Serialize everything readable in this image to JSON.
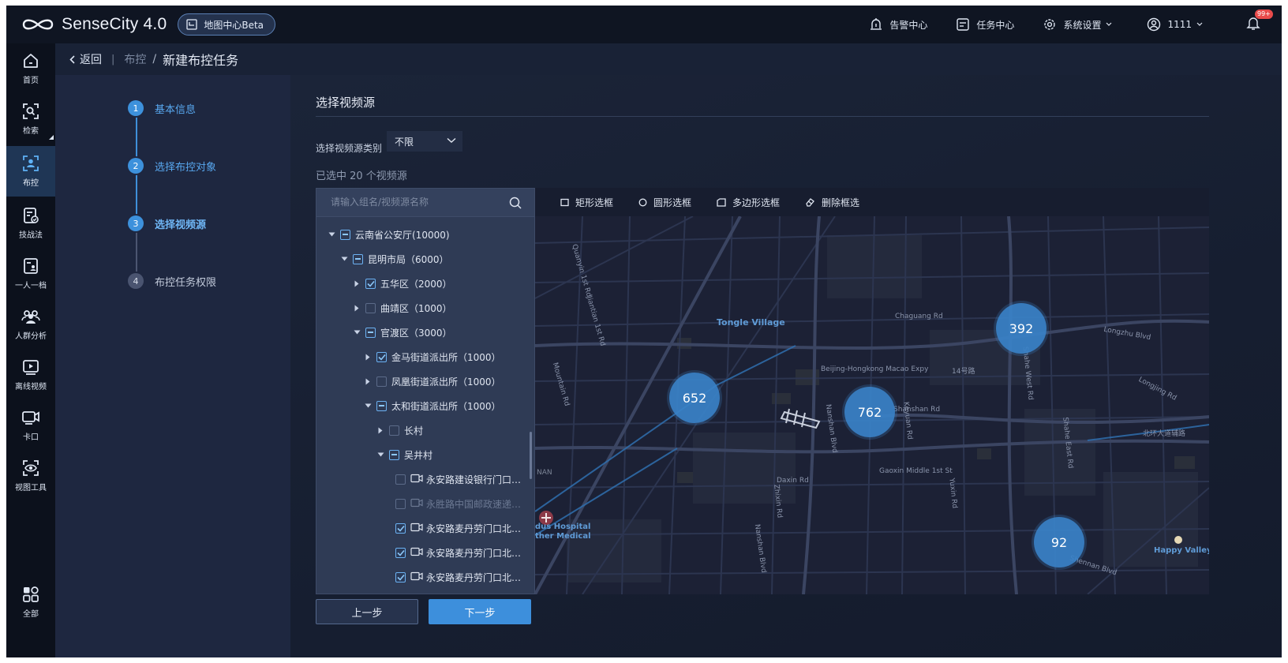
{
  "header": {
    "app_name": "SenseCity 4.0",
    "badge_label": "地图中心Beta",
    "alarm_center": "告警中心",
    "task_center": "任务中心",
    "system_settings": "系统设置",
    "user_name": "1111",
    "notification_count": "99+"
  },
  "nav": {
    "items": [
      {
        "label": "首页",
        "icon": "home-icon"
      },
      {
        "label": "检索",
        "icon": "search-face-icon"
      },
      {
        "label": "布控",
        "icon": "monitor-person-icon",
        "active": true
      },
      {
        "label": "技战法",
        "icon": "tactics-icon"
      },
      {
        "label": "一人一档",
        "icon": "profile-icon"
      },
      {
        "label": "人群分析",
        "icon": "crowd-icon"
      },
      {
        "label": "离线视频",
        "icon": "offline-video-icon"
      },
      {
        "label": "卡口",
        "icon": "checkpoint-camera-icon"
      },
      {
        "label": "视图工具",
        "icon": "view-tool-icon"
      },
      {
        "label": "全部",
        "icon": "all-apps-icon"
      }
    ]
  },
  "breadcrumb": {
    "back": "返回",
    "parent": "布控",
    "separator": "/",
    "current": "新建布控任务"
  },
  "steps": [
    {
      "num": "1",
      "label": "基本信息",
      "state": "done"
    },
    {
      "num": "2",
      "label": "选择布控对象",
      "state": "done"
    },
    {
      "num": "3",
      "label": "选择视频源",
      "state": "current"
    },
    {
      "num": "4",
      "label": "布控任务权限",
      "state": "todo"
    }
  ],
  "main": {
    "section_title": "选择视频源",
    "filter_label": "选择视频源类别",
    "filter_value": "不限",
    "selected_count_text": "已选中 20 个视频源",
    "search_placeholder": "请输入组名/视频源名称"
  },
  "tree": [
    {
      "label": "云南省公安厅(10000)",
      "level": 0,
      "arrow": "down",
      "check": "half"
    },
    {
      "label": "昆明市局（6000）",
      "level": 1,
      "arrow": "down",
      "check": "half"
    },
    {
      "label": "五华区（2000）",
      "level": 2,
      "arrow": "right",
      "check": "on"
    },
    {
      "label": "曲靖区（1000）",
      "level": 2,
      "arrow": "right",
      "check": "off"
    },
    {
      "label": "官渡区（3000）",
      "level": 2,
      "arrow": "down",
      "check": "half"
    },
    {
      "label": "金马街道派出所（1000）",
      "level": 3,
      "arrow": "right",
      "check": "on"
    },
    {
      "label": "凤凰街道派出所（1000）",
      "level": 3,
      "arrow": "right",
      "check": "off"
    },
    {
      "label": "太和街道派出所（1000）",
      "level": 3,
      "arrow": "down",
      "check": "half"
    },
    {
      "label": "长村",
      "level": 4,
      "arrow": "right",
      "check": "off"
    },
    {
      "label": "吴井村",
      "level": 4,
      "arrow": "down",
      "check": "half"
    },
    {
      "label": "永安路建设银行门口…",
      "level": 5,
      "arrow": "none",
      "check": "off",
      "camera": true
    },
    {
      "label": "永胜路中国邮政速递…",
      "level": 5,
      "arrow": "none",
      "check": "off",
      "camera": true,
      "disabled": true
    },
    {
      "label": "永安路麦丹劳门口北…",
      "level": 5,
      "arrow": "none",
      "check": "on",
      "camera": true
    },
    {
      "label": "永安路麦丹劳门口北…",
      "level": 5,
      "arrow": "none",
      "check": "on",
      "camera": true
    },
    {
      "label": "永安路麦丹劳门口北…",
      "level": 5,
      "arrow": "none",
      "check": "on",
      "camera": true
    }
  ],
  "map_tools": {
    "rect": "矩形选框",
    "circle": "圆形选框",
    "polygon": "多边形选框",
    "delete": "删除框选"
  },
  "clusters": [
    "652",
    "762",
    "392",
    "92"
  ],
  "map_labels": {
    "tongle_village": "Tongle Village",
    "chaguang_rd": "Chaguang Rd",
    "beijing_expy": "Beijing-Hongkong Macao Expy",
    "longzhu_blvd": "Longzhu Blvd",
    "longjing_rd": "Longjing Rd",
    "gaoxin_middle": "Gaoxin Middle 1st St",
    "daxin_rd": "Daxin Rd",
    "shanshan_rd": "Shanshan Rd",
    "happy_valley": "Happy Valley",
    "hospital_1": "dus Hospital",
    "hospital_2": "ther Medical",
    "nan": "NAN",
    "rd_14": "14号路",
    "north_ring": "北环大道辅路",
    "shahe_w": "Shahe West Rd",
    "shahe_e": "Shahe East Rd",
    "nanshan_blvd": "Nanshan Blvd",
    "shennan_blvd": "Shennan Blvd",
    "keyuan_rd": "Keyuan Rd",
    "jiantian": "Jiantian 1st Rd",
    "quanyin": "Quanyin 1st Rd",
    "mountain_rd": "Mountain Rd",
    "yuxin_rd": "Yuxin Rd",
    "zhixin_rd": "Zhixin Rd"
  },
  "buttons": {
    "prev": "上一步",
    "next": "下一步"
  }
}
